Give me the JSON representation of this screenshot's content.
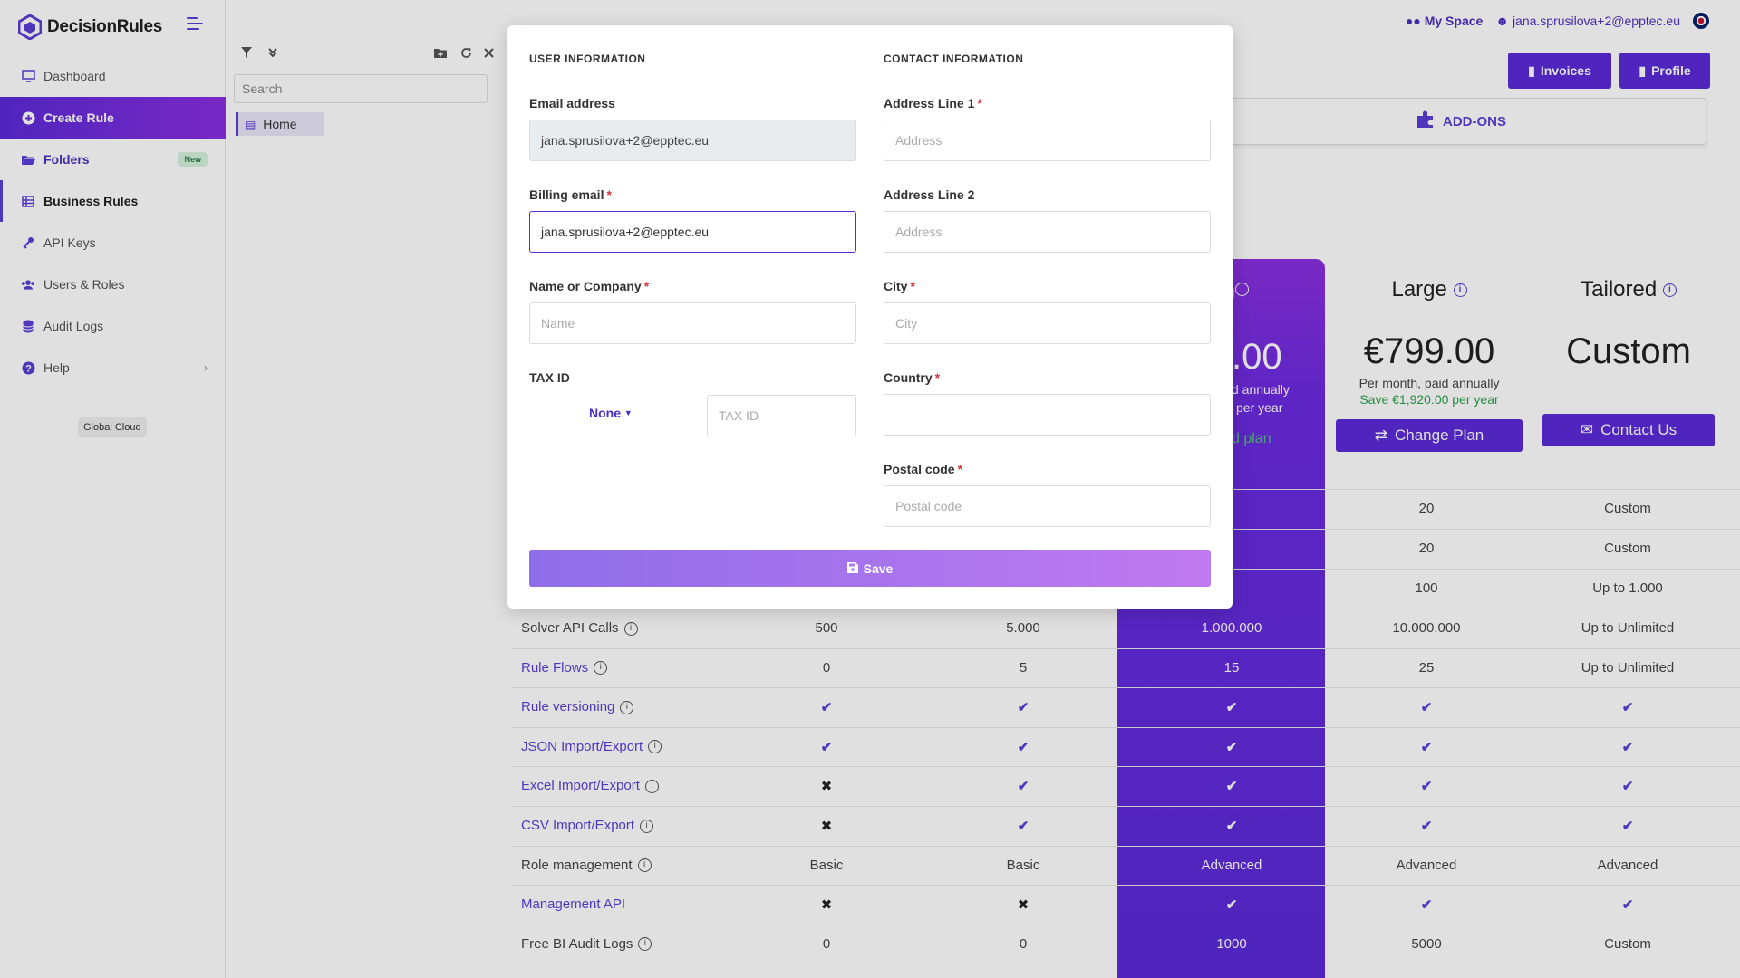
{
  "app": {
    "name": "DecisionRules"
  },
  "sidebar": {
    "items": [
      {
        "label": "Dashboard"
      },
      {
        "label": "Create Rule"
      },
      {
        "label": "Folders",
        "badge": "New"
      },
      {
        "label": "Business Rules"
      },
      {
        "label": "API Keys"
      },
      {
        "label": "Users & Roles"
      },
      {
        "label": "Audit Logs"
      },
      {
        "label": "Help"
      }
    ],
    "cloud_badge": "Global Cloud"
  },
  "folder_panel": {
    "search_placeholder": "Search",
    "home_label": "Home"
  },
  "topbar": {
    "my_space": "My Space",
    "user_email": "jana.sprusilova+2@epptec.eu",
    "invoices_label": "Invoices",
    "profile_label": "Profile",
    "addons_label": "ADD-ONS"
  },
  "plans": {
    "medium": {
      "title_fragment": "m",
      "price_fragment": ".00",
      "sub_fragment": "d annually",
      "save_fragment": "per year",
      "btn_fragment": "d plan"
    },
    "large": {
      "title": "Large",
      "price": "€799.00",
      "sub": "Per month, paid annually",
      "save": "Save €1,920.00 per year",
      "button": "Change Plan"
    },
    "tailored": {
      "title": "Tailored",
      "price": "Custom",
      "button": "Contact Us"
    }
  },
  "table": {
    "partial_rows": [
      {
        "large": "20",
        "tailored": "Custom"
      },
      {
        "large": "20",
        "tailored": "Custom"
      },
      {
        "large": "100",
        "tailored": "Up to 1.000"
      }
    ],
    "rows": [
      {
        "label": "Solver API Calls",
        "link": false,
        "info": true,
        "free": "500",
        "small": "5.000",
        "medium": "1.000.000",
        "large": "10.000.000",
        "tailored": "Up to Unlimited"
      },
      {
        "label": "Rule Flows",
        "link": true,
        "info": true,
        "free": "0",
        "small": "5",
        "medium": "15",
        "large": "25",
        "tailored": "Up to Unlimited"
      },
      {
        "label": "Rule versioning",
        "link": true,
        "info": true,
        "free": "✔",
        "small": "✔",
        "medium": "✔",
        "large": "✔",
        "tailored": "✔"
      },
      {
        "label": "JSON Import/Export",
        "link": true,
        "info": true,
        "free": "✔",
        "small": "✔",
        "medium": "✔",
        "large": "✔",
        "tailored": "✔"
      },
      {
        "label": "Excel Import/Export",
        "link": true,
        "info": true,
        "free": "✖",
        "small": "✔",
        "medium": "✔",
        "large": "✔",
        "tailored": "✔"
      },
      {
        "label": "CSV Import/Export",
        "link": true,
        "info": true,
        "free": "✖",
        "small": "✔",
        "medium": "✔",
        "large": "✔",
        "tailored": "✔"
      },
      {
        "label": "Role management",
        "link": false,
        "info": true,
        "free": "Basic",
        "small": "Basic",
        "medium": "Advanced",
        "large": "Advanced",
        "tailored": "Advanced"
      },
      {
        "label": "Management API",
        "link": true,
        "info": false,
        "free": "✖",
        "small": "✖",
        "medium": "✔",
        "large": "✔",
        "tailored": "✔"
      },
      {
        "label": "Free BI Audit Logs",
        "link": false,
        "info": true,
        "free": "0",
        "small": "0",
        "medium": "1000",
        "large": "5000",
        "tailored": "Custom"
      }
    ]
  },
  "modal": {
    "user_section_title": "USER INFORMATION",
    "contact_section_title": "CONTACT INFORMATION",
    "email_label": "Email address",
    "email_value": "jana.sprusilova+2@epptec.eu",
    "billing_email_label": "Billing email",
    "billing_email_value": "jana.sprusilova+2@epptec.eu",
    "name_label": "Name or Company",
    "name_placeholder": "Name",
    "tax_label": "TAX ID",
    "tax_type_value": "None",
    "tax_placeholder": "TAX ID",
    "address1_label": "Address Line 1",
    "address1_placeholder": "Address",
    "address2_label": "Address Line 2",
    "address2_placeholder": "Address",
    "city_label": "City",
    "city_placeholder": "City",
    "country_label": "Country",
    "country_value": "",
    "postal_label": "Postal code",
    "postal_placeholder": "Postal code",
    "save_label": "Save"
  },
  "colors": {
    "accent": "#5b2bd8",
    "accent_light": "#8a2fe0",
    "success": "#2aa14a",
    "required": "#d9363e"
  }
}
